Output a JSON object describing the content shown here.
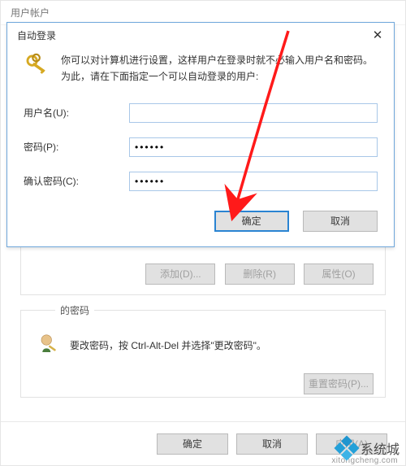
{
  "parent": {
    "title": "用户帐户",
    "buttons": {
      "add": "添加(D)...",
      "remove": "删除(R)",
      "props": "属性(O)"
    },
    "pw_group_label": "的密码",
    "pw_instruction": "要改密码，按 Ctrl-Alt-Del 并选择\"更改密码\"。",
    "reset_pw": "重置密码(P)...",
    "footer": {
      "ok": "确定",
      "cancel": "取消",
      "apply": "应用(A)"
    }
  },
  "modal": {
    "title": "自动登录",
    "intro_line1": "你可以对计算机进行设置，这样用户在登录时就不必输入用户名和密码。",
    "intro_line2": "为此，请在下面指定一个可以自动登录的用户:",
    "username_label": "用户名(U):",
    "username_value": "",
    "password_label": "密码(P):",
    "password_value": "••••••",
    "confirm_label": "确认密码(C):",
    "confirm_value": "••••••",
    "ok": "确定",
    "cancel": "取消"
  },
  "watermark": {
    "text": "系统城",
    "url": "xitongcheng.com"
  }
}
